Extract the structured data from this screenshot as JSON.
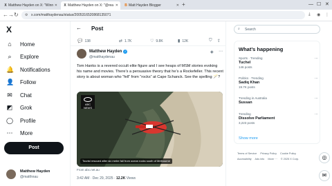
{
  "browser": {
    "tabs": [
      {
        "favicon": "X",
        "title": "Matthew Hayden on X: \"Winn"
      },
      {
        "favicon": "X",
        "title": "Matthew Hayden on X: \"@rea"
      },
      {
        "favicon": "B",
        "title": "Matt Hayden Blogger"
      }
    ],
    "new_tab": "+",
    "url": "x.com/matthaydenau/status/2005316520868135071"
  },
  "sidebar": {
    "logo": "X",
    "items": [
      {
        "icon": "home-icon",
        "glyph": "⌂",
        "label": "Home"
      },
      {
        "icon": "search-icon",
        "glyph": "⌕",
        "label": "Explore"
      },
      {
        "icon": "bell-icon",
        "glyph": "🔔",
        "label": "Notifications"
      },
      {
        "icon": "follow-icon",
        "glyph": "👤",
        "label": "Follow"
      },
      {
        "icon": "chat-icon",
        "glyph": "✉",
        "label": "Chat"
      },
      {
        "icon": "grok-icon",
        "glyph": "◩",
        "label": "Grok"
      },
      {
        "icon": "profile-icon",
        "glyph": "◯",
        "label": "Profile"
      },
      {
        "icon": "more-icon",
        "glyph": "⋯",
        "label": "More"
      }
    ],
    "post_label": "Post",
    "account": {
      "name": "Matthew Hayden",
      "handle": "@matthnau"
    }
  },
  "main": {
    "title": "Post",
    "actions": {
      "replies": "138",
      "reposts": "1.7K",
      "likes": "9.8K",
      "views": "12K"
    },
    "tweet": {
      "name": "Matthew Hayden",
      "handle": "@matthaydenau",
      "text": "Tom Hanks is a revered occult elite figure and I see heaps of MSM stories evoking his name and movies. There’s a persuasive theory that he’s a Rockefeller. This recent story is about woman who “fell” from “rocks” at Cape Schanck. See the spelling 🪄?",
      "media_logo": "ABC NEWS",
      "media_caption": "Tourist rescued after six metre fall from ocean rocks south of Melbourne",
      "from": "From abc.net.au",
      "time": "3:42 AM · Dec 29, 2025 · ",
      "views": "12.2K",
      "views_label": " Views"
    }
  },
  "right": {
    "search_placeholder": "Search",
    "trends_title": "What’s happening",
    "trends": [
      {
        "category": "Sports · Trending",
        "name": "Tuchel",
        "count": "146 posts"
      },
      {
        "category": "Politics · Trending",
        "name": "Sadiq Khan",
        "count": "19.7K posts"
      },
      {
        "category": "Trending in Australia",
        "name": "Sussan",
        "count": ""
      },
      {
        "category": "Trending",
        "name": "Dissolve Parliament",
        "count": "3,223 posts"
      }
    ],
    "show_more": "Show more",
    "footer": [
      "Terms of Service",
      "Privacy Policy",
      "Cookie Policy",
      "Accessibility",
      "Ads info",
      "More ···",
      "© 2025 X Corp."
    ]
  }
}
